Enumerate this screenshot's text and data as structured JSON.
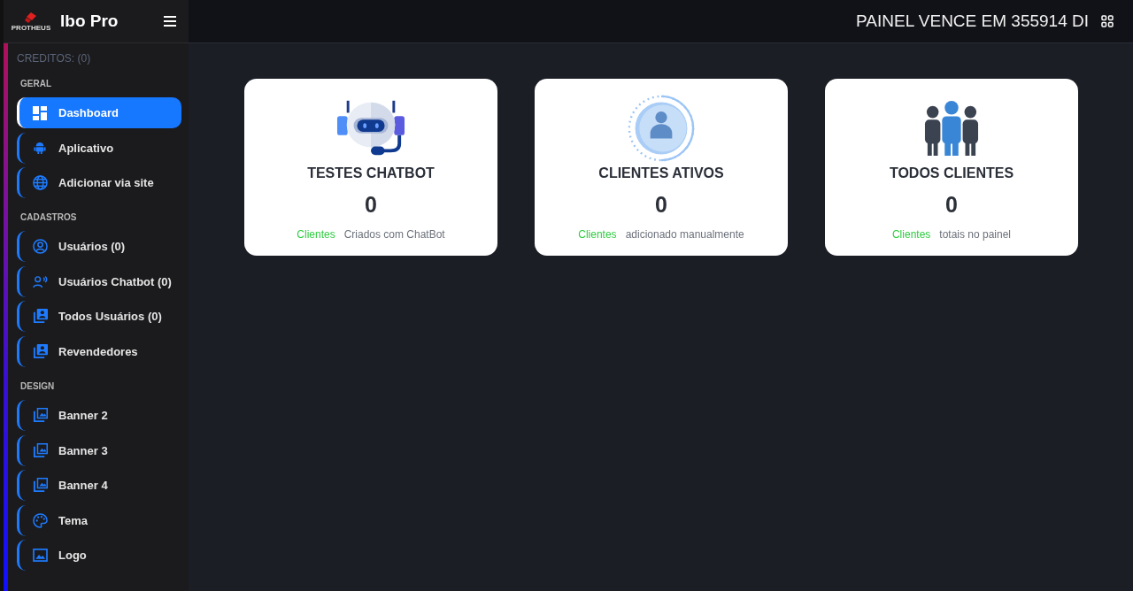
{
  "brand": {
    "logo_text": "PROTHEUS",
    "name": "Ibo Pro"
  },
  "header": {
    "title": "PAINEL VENCE EM 355914 DI"
  },
  "credits": "CREDITOS: (0)",
  "sections": [
    {
      "title": "GERAL",
      "items": [
        {
          "label": "Dashboard",
          "selected": true
        },
        {
          "label": "Aplicativo",
          "selected": false
        },
        {
          "label": "Adicionar via site",
          "selected": false
        }
      ]
    },
    {
      "title": "CADASTROS",
      "items": [
        {
          "label": "Usuários (0)",
          "selected": false
        },
        {
          "label": "Usuários Chatbot (0)",
          "selected": false
        },
        {
          "label": "Todos Usuários (0)",
          "selected": false
        },
        {
          "label": "Revendedores",
          "selected": false
        }
      ]
    },
    {
      "title": "DESIGN",
      "items": [
        {
          "label": "Banner 2",
          "selected": false
        },
        {
          "label": "Banner 3",
          "selected": false
        },
        {
          "label": "Banner 4",
          "selected": false
        },
        {
          "label": "Tema",
          "selected": false
        },
        {
          "label": "Logo",
          "selected": false
        }
      ]
    }
  ],
  "cards": [
    {
      "title": "TESTES CHATBOT",
      "value": "0",
      "tag": "Clientes",
      "note": "Criados com ChatBot"
    },
    {
      "title": "CLIENTES ATIVOS",
      "value": "0",
      "tag": "Clientes",
      "note": "adicionado manualmente"
    },
    {
      "title": "TODOS CLIENTES",
      "value": "0",
      "tag": "Clientes",
      "note": "totais no painel"
    }
  ]
}
